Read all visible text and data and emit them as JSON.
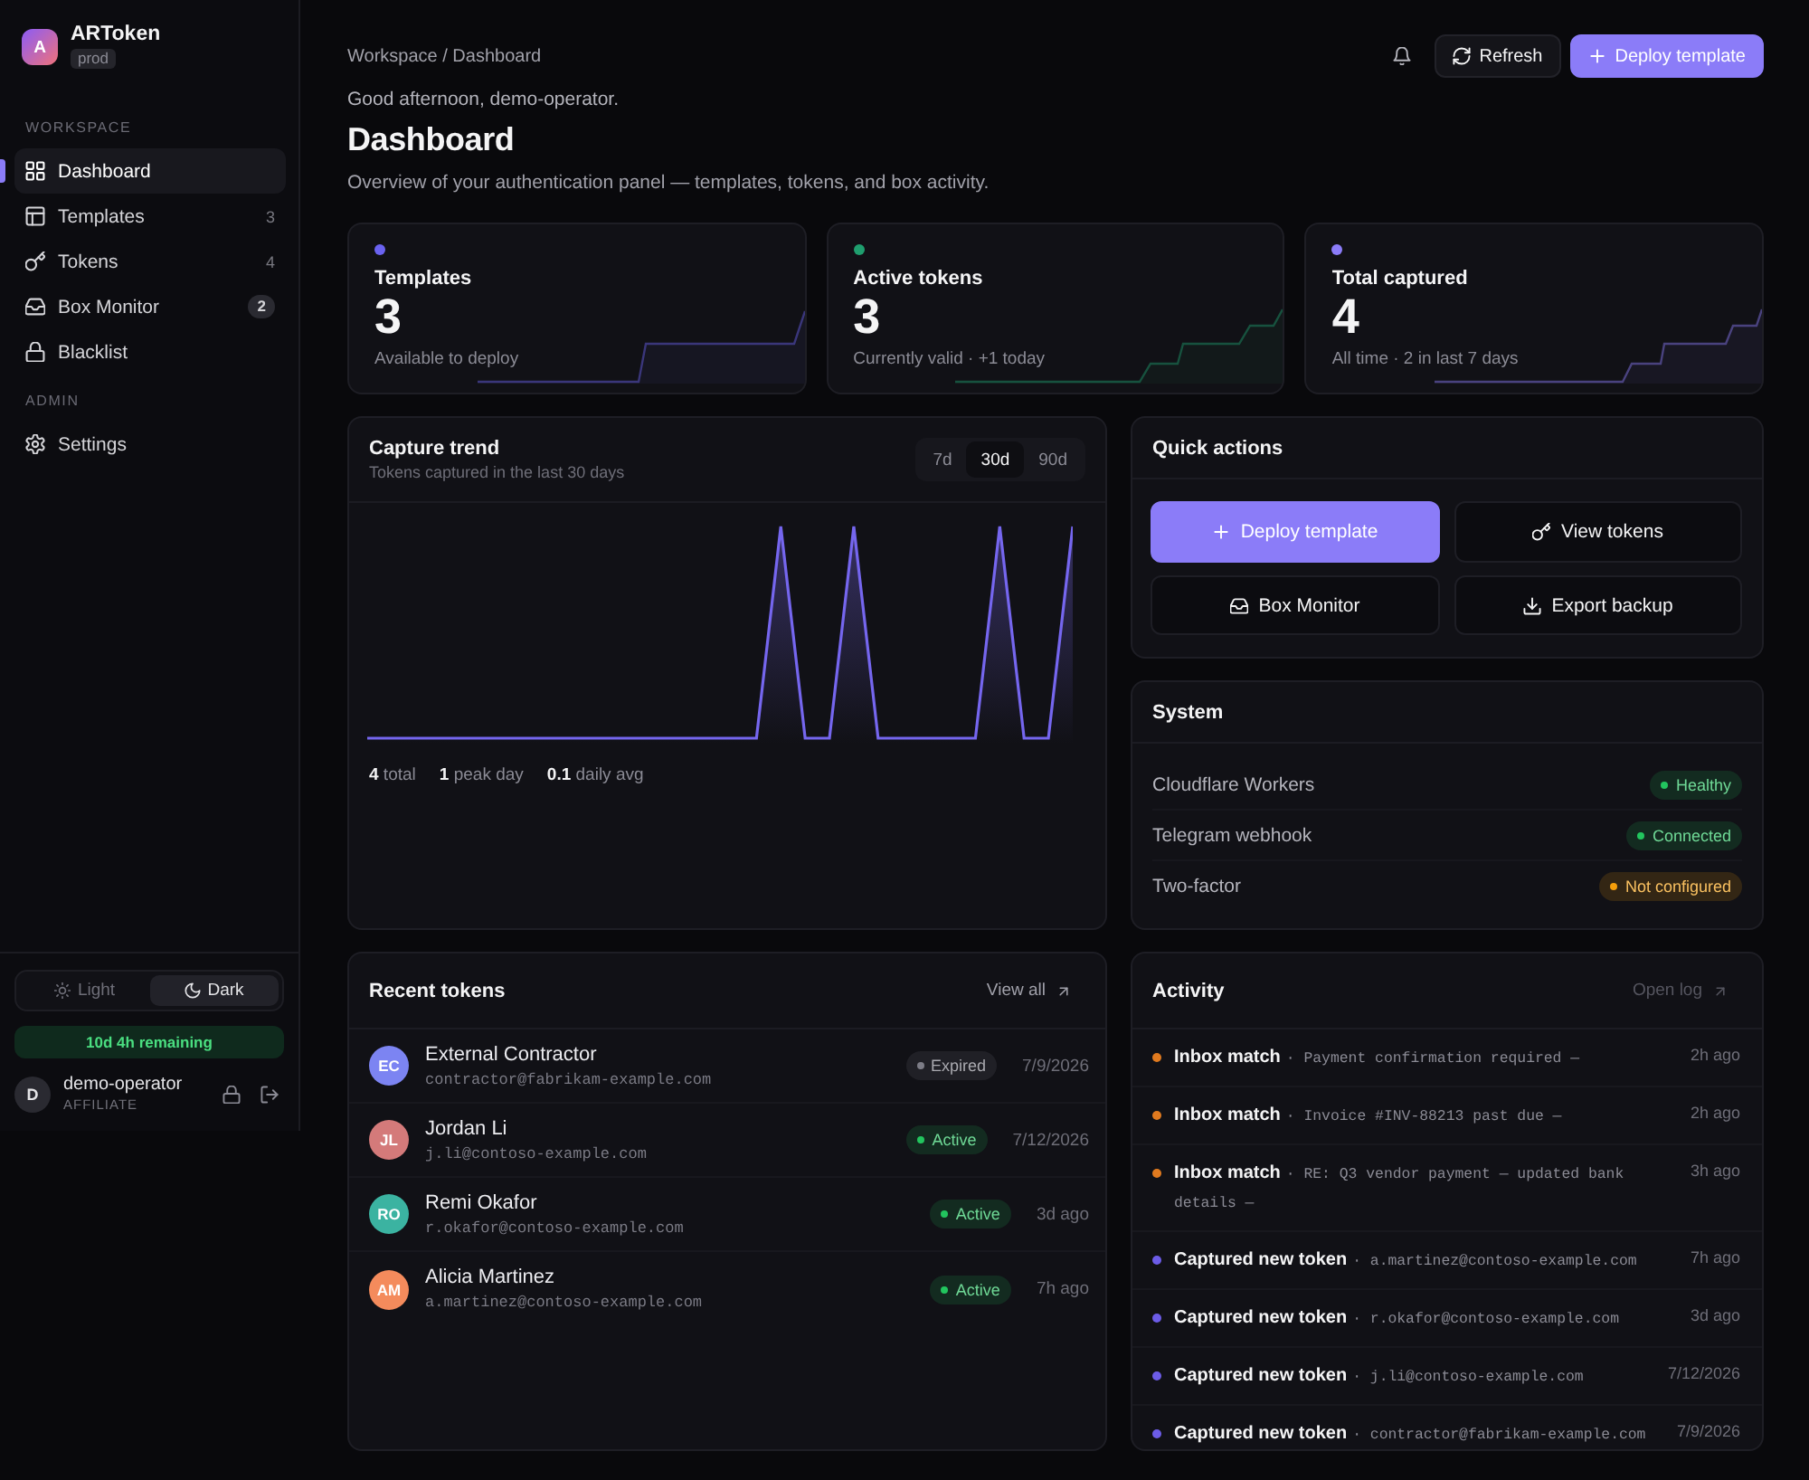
{
  "sidebar": {
    "brand": {
      "logo_letter": "A",
      "name": "ARToken",
      "env": "prod"
    },
    "sections": [
      {
        "label": "WORKSPACE",
        "items": [
          {
            "label": "Dashboard",
            "selected": true
          },
          {
            "label": "Templates",
            "count": "3",
            "selected": false
          },
          {
            "label": "Tokens",
            "count": "4",
            "selected": false
          },
          {
            "label": "Box Monitor",
            "badge": "2",
            "selected": false
          },
          {
            "label": "Blacklist",
            "selected": false
          }
        ]
      },
      {
        "label": "ADMIN",
        "items": [
          {
            "label": "Settings",
            "selected": false
          }
        ]
      }
    ],
    "theme_toggle": [
      {
        "label": "Light",
        "selected": false
      },
      {
        "label": "Dark",
        "selected": true
      }
    ],
    "license": "10d 4h remaining",
    "user": {
      "initial": "D",
      "name": "demo-operator",
      "role": "AFFILIATE"
    }
  },
  "header": {
    "breadcrumb": "Workspace / Dashboard",
    "actions": [
      {
        "label": "Refresh",
        "kind": "secondary"
      },
      {
        "label": "Deploy template",
        "kind": "primary"
      }
    ]
  },
  "greeting": "Good afternoon, demo-operator.",
  "title": "Dashboard",
  "subtitle": "Overview of your authentication panel — templates, tokens, and box activity.",
  "stats": [
    {
      "label": "Templates",
      "value": "3",
      "note": "Available to deploy",
      "color": "#6a62f0"
    },
    {
      "label": "Active tokens",
      "value": "3",
      "note": "Currently valid · +1 today",
      "color": "#1f9e6e"
    },
    {
      "label": "Total captured",
      "value": "4",
      "note": "All time · 2 in last 7 days",
      "color": "#8b7cf8"
    }
  ],
  "capture_trend": {
    "title": "Capture trend",
    "subtitle": "Tokens captured in the last 30 days",
    "ranges": [
      {
        "label": "7d",
        "selected": false
      },
      {
        "label": "30d",
        "selected": true
      },
      {
        "label": "90d",
        "selected": false
      }
    ],
    "summary": [
      "**4** total",
      "**1** peak day",
      "**0.1** daily avg"
    ]
  },
  "quick_actions": {
    "title": "Quick actions",
    "buttons": [
      {
        "label": "Deploy template",
        "kind": "primary"
      },
      {
        "label": "View tokens",
        "kind": "secondary"
      },
      {
        "label": "Box Monitor",
        "kind": "secondary"
      },
      {
        "label": "Export backup",
        "kind": "secondary"
      }
    ]
  },
  "system": {
    "title": "System",
    "rows": [
      {
        "label": "Cloudflare Workers",
        "status": {
          "label": "Healthy",
          "color": "#22c55e"
        }
      },
      {
        "label": "Telegram webhook",
        "status": {
          "label": "Connected",
          "color": "#22c55e"
        }
      },
      {
        "label": "Two-factor",
        "status": {
          "label": "Not configured",
          "color": "#f59e0b"
        }
      }
    ]
  },
  "recent_tokens": {
    "title": "Recent tokens",
    "link": {
      "label": "View all",
      "disabled": false
    },
    "rows": [
      {
        "initials": "EC",
        "color": "#7c84f2",
        "name": "External Contractor",
        "email": "contractor@fabrikam-example.com",
        "status": {
          "label": "Expired",
          "color": "#7c7c86"
        },
        "time": "7/9/2026"
      },
      {
        "initials": "JL",
        "color": "#d47a7a",
        "name": "Jordan Li",
        "email": "j.li@contoso-example.com",
        "status": {
          "label": "Active",
          "color": "#22c55e"
        },
        "time": "7/12/2026"
      },
      {
        "initials": "RO",
        "color": "#3bb3a1",
        "name": "Remi Okafor",
        "email": "r.okafor@contoso-example.com",
        "status": {
          "label": "Active",
          "color": "#22c55e"
        },
        "time": "3d ago"
      },
      {
        "initials": "AM",
        "color": "#f48b5c",
        "name": "Alicia Martinez",
        "email": "a.martinez@contoso-example.com",
        "status": {
          "label": "Active",
          "color": "#22c55e"
        },
        "time": "7h ago"
      }
    ]
  },
  "activity": {
    "title": "Activity",
    "link": {
      "label": "Open log",
      "disabled": true
    },
    "items": [
      {
        "color": "#e07a1f",
        "title": "Inbox match",
        "detail": "· Payment confirmation required —",
        "time": "2h ago"
      },
      {
        "color": "#e07a1f",
        "title": "Inbox match",
        "detail": "· Invoice #INV-88213 past due —",
        "time": "2h ago"
      },
      {
        "color": "#e07a1f",
        "title": "Inbox match",
        "detail": "· RE: Q3 vendor payment — updated bank details —",
        "time": "3h ago"
      },
      {
        "color": "#6c5ce7",
        "title": "Captured new token",
        "detail": "· a.martinez@contoso-example.com",
        "time": "7h ago"
      },
      {
        "color": "#6c5ce7",
        "title": "Captured new token",
        "detail": "· r.okafor@contoso-example.com",
        "time": "3d ago"
      },
      {
        "color": "#6c5ce7",
        "title": "Captured new token",
        "detail": "· j.li@contoso-example.com",
        "time": "7/12/2026"
      },
      {
        "color": "#6c5ce7",
        "title": "Captured new token",
        "detail": "· contractor@fabrikam-example.com",
        "time": "7/9/2026"
      }
    ]
  }
}
